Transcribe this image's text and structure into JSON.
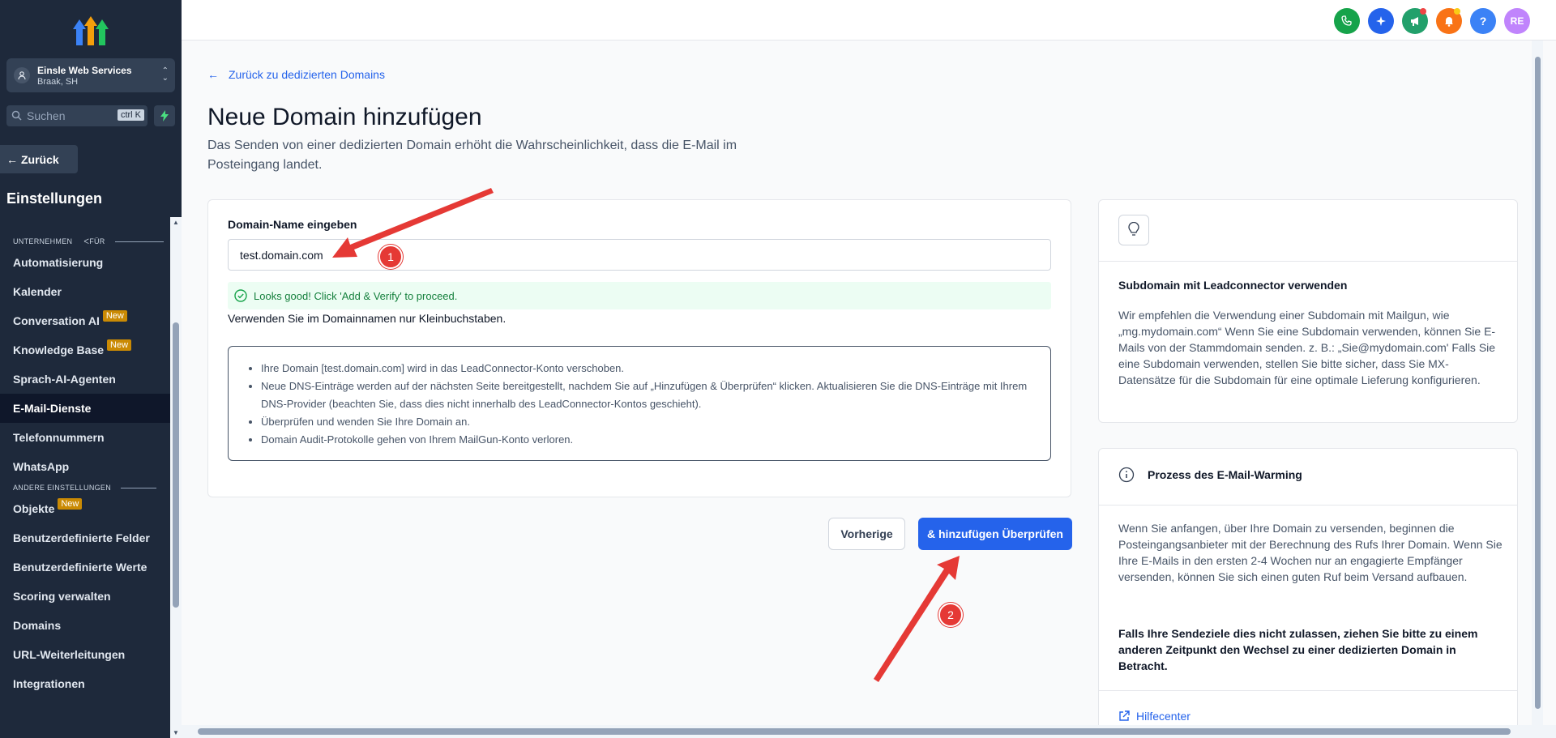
{
  "sidebar": {
    "account_name": "Einsle Web Services",
    "account_location": "Braak, SH",
    "search_placeholder": "Suchen",
    "search_shortcut": "ctrl K",
    "back_label": "Zurück",
    "settings_title": "Einstellungen",
    "section_company": "UNTERNEHMEN",
    "section_company_suffix": "FÜR",
    "section_other": "ANDERE EINSTELLUNGEN",
    "new_badge": "New",
    "items": [
      {
        "label": "Automatisierung"
      },
      {
        "label": "Kalender"
      },
      {
        "label": "Conversation AI",
        "badge": "New"
      },
      {
        "label": "Knowledge Base",
        "badge": "New"
      },
      {
        "label": "Sprach-AI-Agenten"
      },
      {
        "label": "E-Mail-Dienste",
        "active": true
      },
      {
        "label": "Telefonnummern"
      },
      {
        "label": "WhatsApp"
      }
    ],
    "other_items": [
      {
        "label": "Objekte",
        "badge": "New"
      },
      {
        "label": "Benutzerdefinierte Felder"
      },
      {
        "label": "Benutzerdefinierte Werte"
      },
      {
        "label": "Scoring verwalten"
      },
      {
        "label": "Domains"
      },
      {
        "label": "URL-Weiterleitungen"
      },
      {
        "label": "Integrationen"
      }
    ]
  },
  "topbar": {
    "avatar_initials": "RE",
    "help_label": "?",
    "colors": {
      "phone": "#16a34a",
      "magic": "#2563eb",
      "megaphone": "#22a06b",
      "bell": "#f97316",
      "help": "#3b82f6",
      "avatar": "#c084fc"
    }
  },
  "main": {
    "breadcrumb": "Zurück zu dedizierten Domains",
    "title": "Neue Domain hinzufügen",
    "subtitle": "Das Senden von einer dedizierten Domain erhöht die Wahrscheinlichkeit, dass die E-Mail im Posteingang landet.",
    "field_label": "Domain-Name eingeben",
    "field_value": "test.domain.com",
    "success_message": "Looks good! Click 'Add & Verify' to proceed.",
    "hint": "Verwenden Sie im Domainnamen nur Kleinbuchstaben.",
    "info_items": [
      "Ihre Domain [test.domain.com] wird in das LeadConnector-Konto verschoben.",
      "Neue DNS-Einträge werden auf der nächsten Seite bereitgestellt, nachdem Sie auf „Hinzufügen & Überprüfen“ klicken. Aktualisieren Sie die DNS-Einträge mit Ihrem DNS-Provider (beachten Sie, dass dies nicht innerhalb des LeadConnector-Kontos geschieht).",
      "Überprüfen und wenden Sie Ihre Domain an.",
      "Domain Audit-Protokolle gehen von Ihrem MailGun-Konto verloren."
    ],
    "btn_prev": "Vorherige",
    "btn_add": "& hinzufügen Überprüfen"
  },
  "right": {
    "card1_title": "Subdomain mit Leadconnector verwenden",
    "card1_text": "Wir empfehlen die Verwendung einer Subdomain mit Mailgun, wie „mg.mydomain.com“ Wenn Sie eine Subdomain verwenden, können Sie E-Mails von der Stammdomain senden. z. B.: „Sie@mydomain.com' Falls Sie eine Subdomain verwenden, stellen Sie bitte sicher, dass Sie MX-Datensätze für die Subdomain für eine optimale Lieferung konfigurieren.",
    "card2_title": "Prozess des E-Mail-Warming",
    "card2_text": "Wenn Sie anfangen, über Ihre Domain zu versenden, beginnen die Posteingangsanbieter mit der Berechnung des Rufs Ihrer Domain. Wenn Sie Ihre E-Mails in den ersten 2-4 Wochen nur an engagierte Empfänger versenden, können Sie sich einen guten Ruf beim Versand aufbauen.",
    "card2_bold": "Falls Ihre Sendeziele dies nicht zulassen, ziehen Sie bitte zu einem anderen Zeitpunkt den Wechsel zu einer dedizierten Domain in Betracht.",
    "help_link": "Hilfecenter"
  },
  "annotations": {
    "step1": "1",
    "step2": "2",
    "color": "#e53935"
  }
}
